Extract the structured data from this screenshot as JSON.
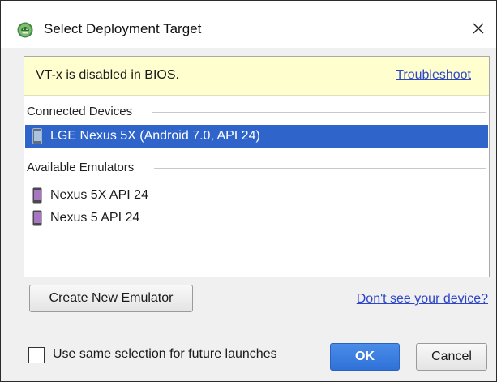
{
  "window": {
    "title": "Select Deployment Target",
    "app_icon": "android-studio-icon",
    "close_icon": "close-icon"
  },
  "warning": {
    "text": "VT-x is disabled in BIOS.",
    "link": "Troubleshoot",
    "background": "#fffecf"
  },
  "connected": {
    "header": "Connected Devices",
    "devices": [
      {
        "label": "LGE Nexus 5X (Android 7.0, API 24)",
        "icon": "phone-icon",
        "selected": true
      }
    ]
  },
  "emulators": {
    "header": "Available Emulators",
    "items": [
      {
        "label": "Nexus 5X API 24",
        "icon": "emulator-phone-icon"
      },
      {
        "label": "Nexus 5 API 24",
        "icon": "emulator-phone-icon"
      }
    ]
  },
  "actions": {
    "create_emulator": "Create New Emulator",
    "dont_see_device": "Don't see your device?",
    "ok": "OK",
    "cancel": "Cancel"
  },
  "options": {
    "same_selection_label": "Use same selection for future launches",
    "same_selection_checked": false
  },
  "colors": {
    "selection": "#2f65ca",
    "link": "#2d46c8",
    "primary_button": "#3a7fe0",
    "emulator_icon": "#8a5aa8"
  }
}
